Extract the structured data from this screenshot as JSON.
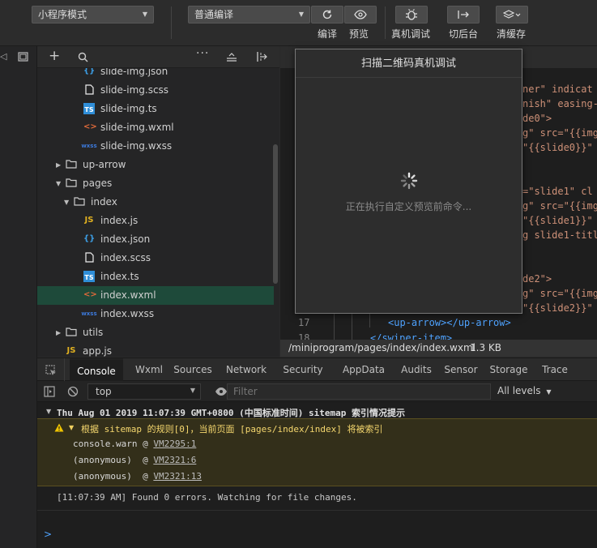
{
  "toolbar": {
    "mode_select": "小程序模式",
    "compile_select": "普通编译",
    "compile_label": "编译",
    "preview_label": "预览",
    "real_debug_label": "真机调试",
    "background_label": "切后台",
    "clear_cache_label": "清缓存"
  },
  "tree": {
    "items": [
      {
        "name": "slide-img.json",
        "icon": "{}",
        "color": "#3c9ee5"
      },
      {
        "name": "slide-img.scss",
        "icon": "file",
        "color": "#ffffff"
      },
      {
        "name": "slide-img.ts",
        "icon": "TS",
        "color": "#2f8ed8"
      },
      {
        "name": "slide-img.wxml",
        "icon": "<>",
        "color": "#e06a3a"
      },
      {
        "name": "slide-img.wxss",
        "icon": "wxss",
        "color": "#3c78d8"
      },
      {
        "name": "up-arrow",
        "icon": "folder",
        "color": "#ccc"
      },
      {
        "name": "pages",
        "icon": "folder",
        "color": "#ccc"
      },
      {
        "name": "index",
        "icon": "folder",
        "color": "#ccc"
      },
      {
        "name": "index.js",
        "icon": "JS",
        "color": "#e0b020"
      },
      {
        "name": "index.json",
        "icon": "{}",
        "color": "#3c9ee5"
      },
      {
        "name": "index.scss",
        "icon": "file",
        "color": "#ffffff"
      },
      {
        "name": "index.ts",
        "icon": "TS",
        "color": "#2f8ed8"
      },
      {
        "name": "index.wxml",
        "icon": "<>",
        "color": "#e06a3a"
      },
      {
        "name": "index.wxss",
        "icon": "wxss",
        "color": "#3c78d8"
      },
      {
        "name": "utils",
        "icon": "folder",
        "color": "#ccc"
      },
      {
        "name": "app.js",
        "icon": "JS",
        "color": "#e0b020"
      }
    ]
  },
  "editor": {
    "lines": [
      "ner\" indicat",
      "nish\" easing-",
      "de0\">",
      "g\" src=\"{{img",
      "\"{{slide0}}\"",
      "=\"slide1\" cl",
      "g\" src=\"{{img",
      "\"{{slide1}}\"",
      "g slide1-titl",
      "de2\">",
      "g\" src=\"{{img",
      "\"{{slide2}}\""
    ],
    "line17_num": "17",
    "line17_code": "<up-arrow></up-arrow>",
    "line18_num": "18",
    "line18_code": "</swiper-item>",
    "file_path": "/miniprogram/pages/index/index.wxml",
    "file_size": "1.3 KB"
  },
  "popup": {
    "title": "扫描二维码真机调试",
    "message": "正在执行自定义预览前命令..."
  },
  "devtools": {
    "tabs": [
      "Console",
      "Wxml",
      "Sources",
      "Network",
      "Security",
      "AppData",
      "Audits",
      "Sensor",
      "Storage",
      "Trace"
    ],
    "context": "top",
    "filter_placeholder": "Filter",
    "levels": "All levels"
  },
  "console": {
    "group_header": "Thu Aug 01 2019 11:07:39 GMT+0800 (中国标准时间) sitemap 索引情况提示",
    "warn_text": "根据 sitemap 的规则[0]，当前页面 [pages/index/index] 将被索引",
    "stack": [
      {
        "fn": "console.warn @ ",
        "link": "VM2295:1"
      },
      {
        "fn": "(anonymous)  @ ",
        "link": "VM2321:6"
      },
      {
        "fn": "(anonymous)  @ ",
        "link": "VM2321:13"
      }
    ],
    "log": "[11:07:39 AM] Found 0 errors. Watching for file changes.",
    "prompt": ">"
  }
}
